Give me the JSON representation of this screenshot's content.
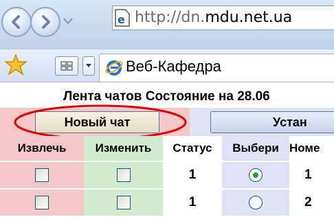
{
  "browser": {
    "address": {
      "prefix": "http://dn.",
      "domain": "mdu.net.ua"
    },
    "tab": {
      "title": "Веб-Кафедра"
    }
  },
  "page": {
    "heading": "Лента чатов  Состояние на 28.06",
    "buttons": {
      "new_chat": "Новый чат",
      "set": "Устан"
    },
    "table": {
      "headers": [
        "Извлечь",
        "Изменить",
        "Статус",
        "Выбери",
        "Номе"
      ],
      "rows": [
        {
          "status": "1",
          "selected": true,
          "number": "1"
        },
        {
          "status": "1",
          "selected": false,
          "number": "2"
        }
      ]
    },
    "colors": {
      "highlight": "#e30000",
      "pink": "#f4c8c8",
      "green": "#cfeccf",
      "lavender": "#dfe3f3"
    }
  }
}
